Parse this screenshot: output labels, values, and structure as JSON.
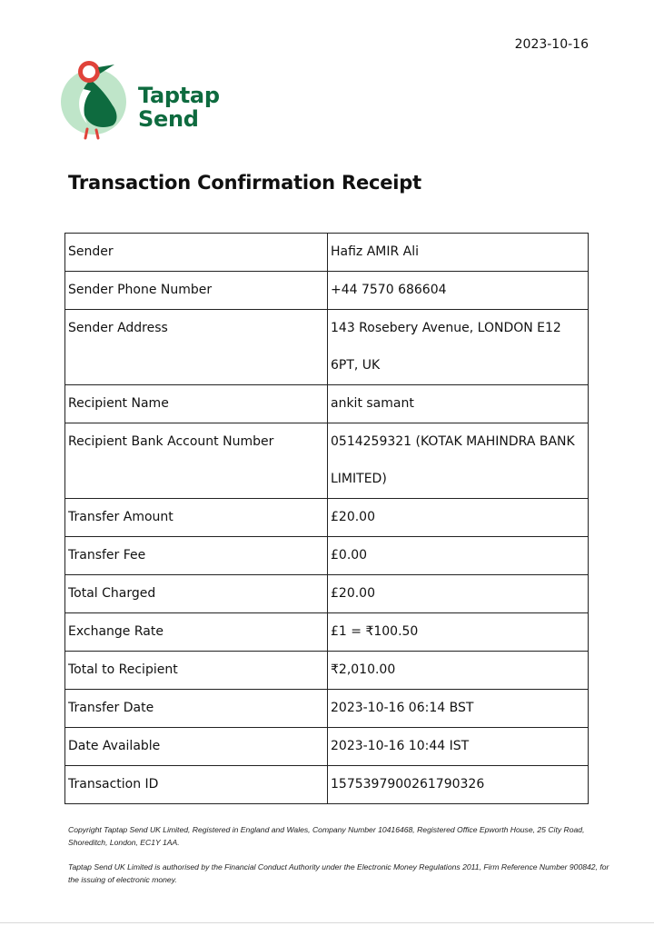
{
  "receipt_date": "2023-10-16",
  "brand": {
    "line1": "Taptap",
    "line2": "Send"
  },
  "title": "Transaction Confirmation Receipt",
  "rows": [
    {
      "label": "Sender",
      "value": "Hafiz AMIR Ali"
    },
    {
      "label": "Sender Phone Number",
      "value": "+44 7570 686604"
    },
    {
      "label": "Sender Address",
      "value": "143 Rosebery Avenue, LONDON E12 6PT, UK"
    },
    {
      "label": "Recipient Name",
      "value": "ankit samant"
    },
    {
      "label": "Recipient Bank Account Number",
      "value": "0514259321 (KOTAK MAHINDRA BANK LIMITED)"
    },
    {
      "label": "Transfer Amount",
      "value": "£20.00"
    },
    {
      "label": "Transfer Fee",
      "value": "£0.00"
    },
    {
      "label": "Total Charged",
      "value": "£20.00"
    },
    {
      "label": "Exchange Rate",
      "value": "£1 = ₹100.50"
    },
    {
      "label": "Total to Recipient",
      "value": "₹2,010.00"
    },
    {
      "label": "Transfer Date",
      "value": "2023-10-16 06:14 BST"
    },
    {
      "label": "Date Available",
      "value": "2023-10-16 10:44 IST"
    },
    {
      "label": "Transaction ID",
      "value": "1575397900261790326"
    }
  ],
  "footer": {
    "copyright": "Copyright Taptap Send UK Limited, Registered in England and Wales, Company Number 10416468, Registered Office Epworth House, 25 City Road, Shoreditch, London, EC1Y 1AA.",
    "regulation": "Taptap Send UK Limited is authorised by the Financial Conduct Authority under the Electronic Money Regulations 2011, Firm Reference Number 900842, for the issuing of electronic money."
  },
  "colors": {
    "brand_green": "#0e6b3f",
    "light_green": "#bfe5c9",
    "accent_red": "#e0433a"
  },
  "icons": {
    "logo": "bird-logo-icon"
  }
}
